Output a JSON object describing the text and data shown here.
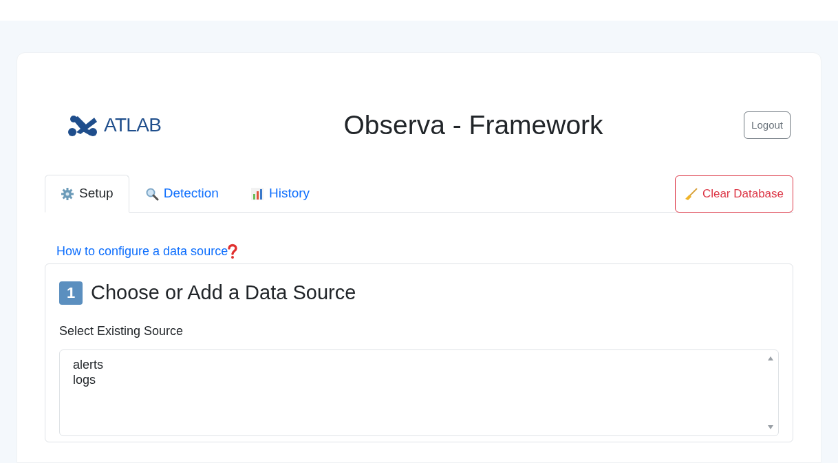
{
  "header": {
    "logo": "ATLAB",
    "title": "Observa - Framework",
    "logout": "Logout"
  },
  "tabs": [
    {
      "label": "Setup",
      "kind": "gear",
      "selected": true
    },
    {
      "label": "Detection",
      "kind": "search",
      "selected": false
    },
    {
      "label": "History",
      "kind": "chart",
      "selected": false
    }
  ],
  "clear_button": "Clear Database",
  "help_link": "How to configure a data source",
  "section": {
    "step_number": "1",
    "title": "Choose or Add a Data Source",
    "field_label": "Select Existing Source",
    "options": [
      {
        "label": "alerts",
        "selected": false
      },
      {
        "label": "logs",
        "selected": false
      }
    ]
  }
}
